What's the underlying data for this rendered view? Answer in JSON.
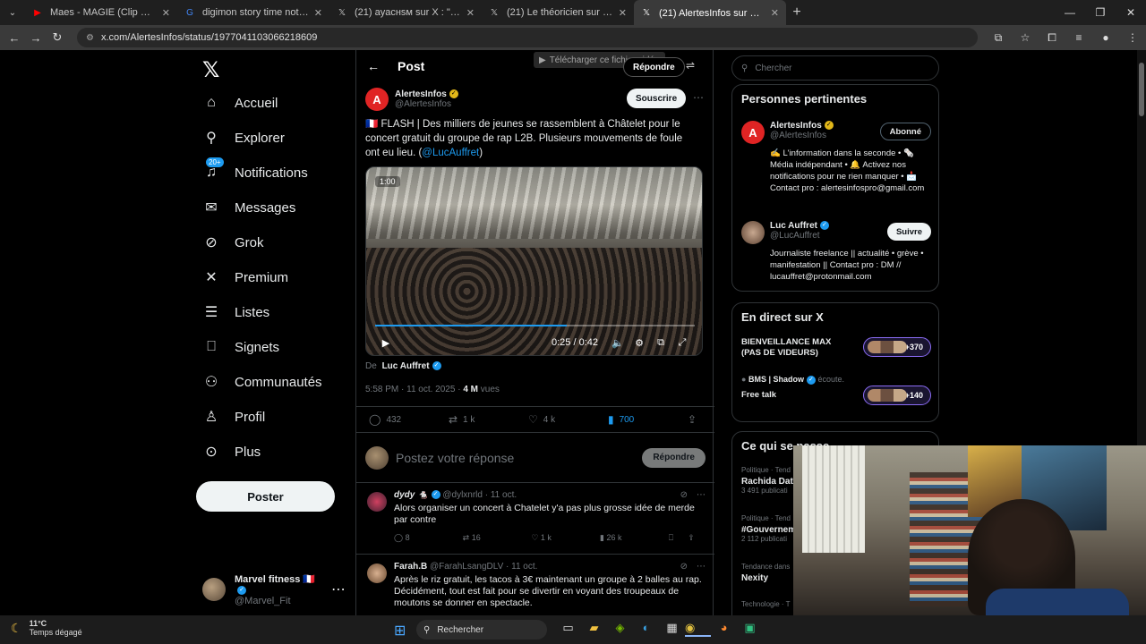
{
  "browser": {
    "tabs": [
      {
        "label": "Maes - MAGIE (Clip Officiel) - Y",
        "icon": "youtube-icon",
        "color": "#ff0000"
      },
      {
        "label": "digimon story time note jvc - R",
        "icon": "google-icon",
        "color": "#4285f4"
      },
      {
        "label": "(21) ayacнsм sur X : \"@SindyOf",
        "icon": "x-icon",
        "color": "#ffffff"
      },
      {
        "label": "(21) Le théoricien sur X : \"Le ren",
        "icon": "x-icon",
        "color": "#ffffff"
      },
      {
        "label": "(21) AlertesInfos sur X : \"🇫🇷 FLAS",
        "icon": "x-icon",
        "color": "#ffffff",
        "active": true
      }
    ],
    "url": "x.com/AlertesInfos/status/1977041103066218609"
  },
  "nav": {
    "items": [
      {
        "label": "Accueil",
        "icon": "home-icon",
        "glyph": "⌂"
      },
      {
        "label": "Explorer",
        "icon": "search-icon",
        "glyph": "⚲"
      },
      {
        "label": "Notifications",
        "icon": "bell-icon",
        "glyph": "🔔",
        "badge": "20+"
      },
      {
        "label": "Messages",
        "icon": "mail-icon",
        "glyph": "✉"
      },
      {
        "label": "Grok",
        "icon": "grok-icon",
        "glyph": "⊘"
      },
      {
        "label": "Premium",
        "icon": "x-premium-icon",
        "glyph": "𝕏"
      },
      {
        "label": "Listes",
        "icon": "list-icon",
        "glyph": "☰"
      },
      {
        "label": "Signets",
        "icon": "bookmark-icon",
        "glyph": "⎕"
      },
      {
        "label": "Communautés",
        "icon": "communities-icon",
        "glyph": "👥"
      },
      {
        "label": "Profil",
        "icon": "profile-icon",
        "glyph": "👤"
      },
      {
        "label": "Plus",
        "icon": "more-icon",
        "glyph": "⋯"
      }
    ],
    "post_label": "Poster",
    "account": {
      "name": "Marvel fitness 🇫🇷",
      "handle": "@Marvel_Fit"
    }
  },
  "header": {
    "title": "Post",
    "download_label": "Télécharger ce fichier vidéo",
    "reply_label": "Répondre"
  },
  "tweet": {
    "author": "AlertesInfos",
    "handle": "@AlertesInfos",
    "subscribe_label": "Souscrire",
    "text": "🇫🇷 FLASH | Des milliers de jeunes se rassemblent à Châtelet pour le concert gratuit du groupe de rap L2B. Plusieurs mouvements de foule ont eu lieu. (",
    "mention": "@LucAuffret",
    "text_end": ")",
    "video": {
      "tag": "1:00",
      "time": "0:25 / 0:42",
      "progress": 0.6
    },
    "from_label": "De",
    "from_name": "Luc Auffret",
    "timestamp": "5:58 PM · 11 oct. 2025 ·",
    "views": "4 M",
    "views_label": "vues",
    "stats": {
      "replies": "432",
      "reposts": "1 k",
      "likes": "4 k",
      "bookmarks": "700"
    }
  },
  "composer": {
    "placeholder": "Postez votre réponse",
    "button": "Répondre"
  },
  "replies": [
    {
      "name": "dydy 🐁",
      "handle": "@dylxnrld",
      "date": "· 11 oct.",
      "text": "Alors organiser un concert à Chatelet y'a pas plus grosse idée de merde par contre",
      "replies": "8",
      "reposts": "16",
      "likes": "1 k",
      "views": "26 k"
    },
    {
      "name": "Farah.B",
      "handle": "@FarahLsangDLV",
      "date": "· 11 oct.",
      "text": "Après le riz gratuit, les tacos à 3€ maintenant un groupe à 2 balles au rap. Décidément, tout est fait pour se divertir en voyant des troupeaux de moutons se donner en spectacle."
    }
  ],
  "sidebar": {
    "search_placeholder": "Chercher",
    "relevant_title": "Personnes pertinentes",
    "people": [
      {
        "name": "AlertesInfos",
        "handle": "@AlertesInfos",
        "button": "Abonné",
        "bio": "✍️ L'information dans la seconde • 🗞️ Média indépendant • 🔔 Activez nos notifications pour ne rien manquer • 📩 Contact pro : alertesinfospro@gmail.com"
      },
      {
        "name": "Luc Auffret",
        "handle": "@LucAuffret",
        "button": "Suivre",
        "bio": "Journaliste freelance || actualité • grève • manifestation || Contact pro : DM // lucauffret@protonmail.com"
      }
    ],
    "live_title": "En direct sur X",
    "live": [
      {
        "title": "BIENVEILLANCE MAX (PAS DE VIDEURS)",
        "count": "+370"
      },
      {
        "host": "BMS | Shadow",
        "host_suffix": "écoute.",
        "title": "Free talk",
        "count": "+140"
      }
    ],
    "trends_title": "Ce qui se passe",
    "trends": [
      {
        "category": "Politique · Tend",
        "name": "Rachida Dat",
        "count": "3 491 publicati"
      },
      {
        "category": "Politique · Tend",
        "name": "#Gouvernem",
        "count": "2 112 publicati"
      },
      {
        "category": "Tendance dans",
        "name": "Nexity",
        "count": ""
      },
      {
        "category": "Technologie · T",
        "name": "",
        "count": ""
      }
    ]
  },
  "taskbar": {
    "temp": "11°C",
    "weather": "Temps dégagé",
    "search": "Rechercher"
  }
}
